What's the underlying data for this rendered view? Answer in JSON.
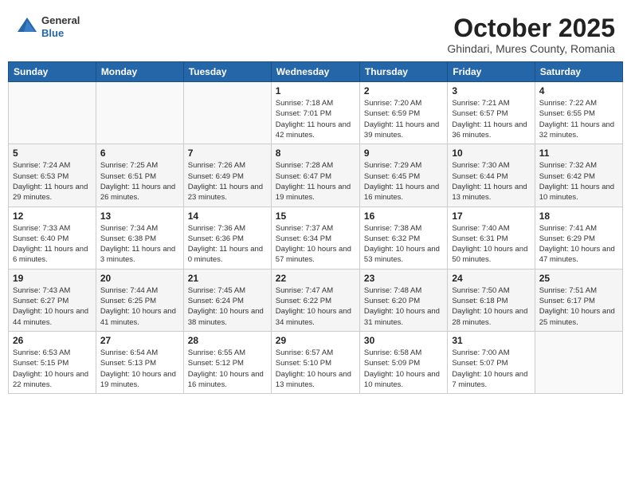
{
  "header": {
    "logo_general": "General",
    "logo_blue": "Blue",
    "month_title": "October 2025",
    "location": "Ghindari, Mures County, Romania"
  },
  "days_of_week": [
    "Sunday",
    "Monday",
    "Tuesday",
    "Wednesday",
    "Thursday",
    "Friday",
    "Saturday"
  ],
  "weeks": [
    [
      {
        "day": "",
        "info": ""
      },
      {
        "day": "",
        "info": ""
      },
      {
        "day": "",
        "info": ""
      },
      {
        "day": "1",
        "info": "Sunrise: 7:18 AM\nSunset: 7:01 PM\nDaylight: 11 hours and 42 minutes."
      },
      {
        "day": "2",
        "info": "Sunrise: 7:20 AM\nSunset: 6:59 PM\nDaylight: 11 hours and 39 minutes."
      },
      {
        "day": "3",
        "info": "Sunrise: 7:21 AM\nSunset: 6:57 PM\nDaylight: 11 hours and 36 minutes."
      },
      {
        "day": "4",
        "info": "Sunrise: 7:22 AM\nSunset: 6:55 PM\nDaylight: 11 hours and 32 minutes."
      }
    ],
    [
      {
        "day": "5",
        "info": "Sunrise: 7:24 AM\nSunset: 6:53 PM\nDaylight: 11 hours and 29 minutes."
      },
      {
        "day": "6",
        "info": "Sunrise: 7:25 AM\nSunset: 6:51 PM\nDaylight: 11 hours and 26 minutes."
      },
      {
        "day": "7",
        "info": "Sunrise: 7:26 AM\nSunset: 6:49 PM\nDaylight: 11 hours and 23 minutes."
      },
      {
        "day": "8",
        "info": "Sunrise: 7:28 AM\nSunset: 6:47 PM\nDaylight: 11 hours and 19 minutes."
      },
      {
        "day": "9",
        "info": "Sunrise: 7:29 AM\nSunset: 6:45 PM\nDaylight: 11 hours and 16 minutes."
      },
      {
        "day": "10",
        "info": "Sunrise: 7:30 AM\nSunset: 6:44 PM\nDaylight: 11 hours and 13 minutes."
      },
      {
        "day": "11",
        "info": "Sunrise: 7:32 AM\nSunset: 6:42 PM\nDaylight: 11 hours and 10 minutes."
      }
    ],
    [
      {
        "day": "12",
        "info": "Sunrise: 7:33 AM\nSunset: 6:40 PM\nDaylight: 11 hours and 6 minutes."
      },
      {
        "day": "13",
        "info": "Sunrise: 7:34 AM\nSunset: 6:38 PM\nDaylight: 11 hours and 3 minutes."
      },
      {
        "day": "14",
        "info": "Sunrise: 7:36 AM\nSunset: 6:36 PM\nDaylight: 11 hours and 0 minutes."
      },
      {
        "day": "15",
        "info": "Sunrise: 7:37 AM\nSunset: 6:34 PM\nDaylight: 10 hours and 57 minutes."
      },
      {
        "day": "16",
        "info": "Sunrise: 7:38 AM\nSunset: 6:32 PM\nDaylight: 10 hours and 53 minutes."
      },
      {
        "day": "17",
        "info": "Sunrise: 7:40 AM\nSunset: 6:31 PM\nDaylight: 10 hours and 50 minutes."
      },
      {
        "day": "18",
        "info": "Sunrise: 7:41 AM\nSunset: 6:29 PM\nDaylight: 10 hours and 47 minutes."
      }
    ],
    [
      {
        "day": "19",
        "info": "Sunrise: 7:43 AM\nSunset: 6:27 PM\nDaylight: 10 hours and 44 minutes."
      },
      {
        "day": "20",
        "info": "Sunrise: 7:44 AM\nSunset: 6:25 PM\nDaylight: 10 hours and 41 minutes."
      },
      {
        "day": "21",
        "info": "Sunrise: 7:45 AM\nSunset: 6:24 PM\nDaylight: 10 hours and 38 minutes."
      },
      {
        "day": "22",
        "info": "Sunrise: 7:47 AM\nSunset: 6:22 PM\nDaylight: 10 hours and 34 minutes."
      },
      {
        "day": "23",
        "info": "Sunrise: 7:48 AM\nSunset: 6:20 PM\nDaylight: 10 hours and 31 minutes."
      },
      {
        "day": "24",
        "info": "Sunrise: 7:50 AM\nSunset: 6:18 PM\nDaylight: 10 hours and 28 minutes."
      },
      {
        "day": "25",
        "info": "Sunrise: 7:51 AM\nSunset: 6:17 PM\nDaylight: 10 hours and 25 minutes."
      }
    ],
    [
      {
        "day": "26",
        "info": "Sunrise: 6:53 AM\nSunset: 5:15 PM\nDaylight: 10 hours and 22 minutes."
      },
      {
        "day": "27",
        "info": "Sunrise: 6:54 AM\nSunset: 5:13 PM\nDaylight: 10 hours and 19 minutes."
      },
      {
        "day": "28",
        "info": "Sunrise: 6:55 AM\nSunset: 5:12 PM\nDaylight: 10 hours and 16 minutes."
      },
      {
        "day": "29",
        "info": "Sunrise: 6:57 AM\nSunset: 5:10 PM\nDaylight: 10 hours and 13 minutes."
      },
      {
        "day": "30",
        "info": "Sunrise: 6:58 AM\nSunset: 5:09 PM\nDaylight: 10 hours and 10 minutes."
      },
      {
        "day": "31",
        "info": "Sunrise: 7:00 AM\nSunset: 5:07 PM\nDaylight: 10 hours and 7 minutes."
      },
      {
        "day": "",
        "info": ""
      }
    ]
  ]
}
